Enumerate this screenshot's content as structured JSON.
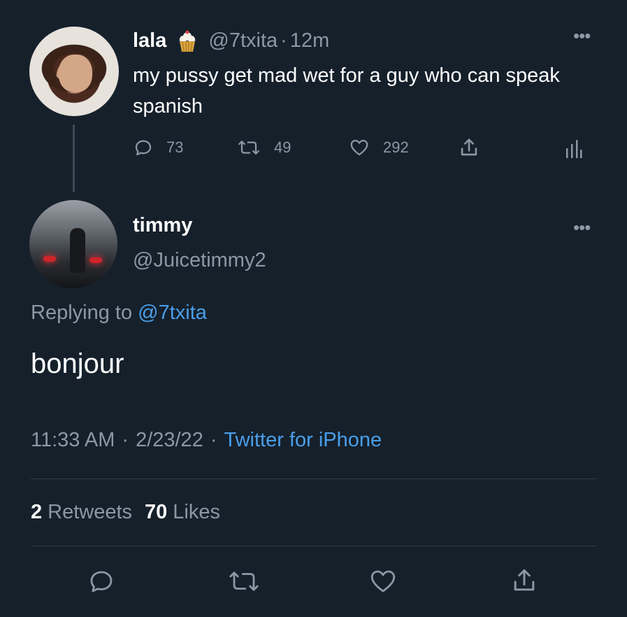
{
  "parent_tweet": {
    "display_name": "lala",
    "badge_icon": "cupcake-emoji",
    "handle": "@7txita",
    "separator": "·",
    "time_ago": "12m",
    "text": "my pussy get mad wet for a guy who can speak spanish",
    "reply_count": "73",
    "retweet_count": "49",
    "like_count": "292"
  },
  "reply_tweet": {
    "display_name": "timmy",
    "handle": "@Juicetimmy2",
    "replying_to_label": "Replying to",
    "replying_to_handle": "@7txita",
    "text": "bonjour",
    "time": "11:33 AM",
    "sep1": "·",
    "date": "2/23/22",
    "sep2": "·",
    "source": "Twitter for iPhone",
    "retweets_count": "2",
    "retweets_label": "Retweets",
    "likes_count": "70",
    "likes_label": "Likes"
  },
  "colors": {
    "background": "#15202b",
    "text": "#ffffff",
    "muted": "#8b98a5",
    "link": "#4a9ee8",
    "divider": "#2f3b47"
  }
}
